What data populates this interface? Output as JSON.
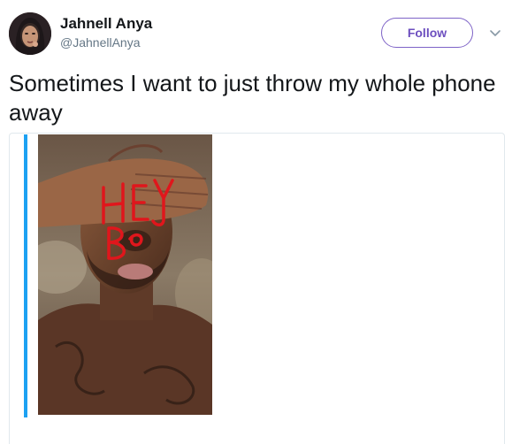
{
  "user": {
    "display_name": "Jahnell Anya",
    "handle": "@JahnellAnya"
  },
  "header": {
    "follow_label": "Follow",
    "menu_icon": "chevron-down-icon"
  },
  "tweet": {
    "text": "Sometimes I want to just throw my whole phone away"
  },
  "media": {
    "drawn_letters": "HEY B",
    "accent_color": "#1da1f2"
  },
  "colors": {
    "follow_border": "#7e63c7",
    "handle_text": "#657786",
    "drawing": "#e0161c"
  }
}
